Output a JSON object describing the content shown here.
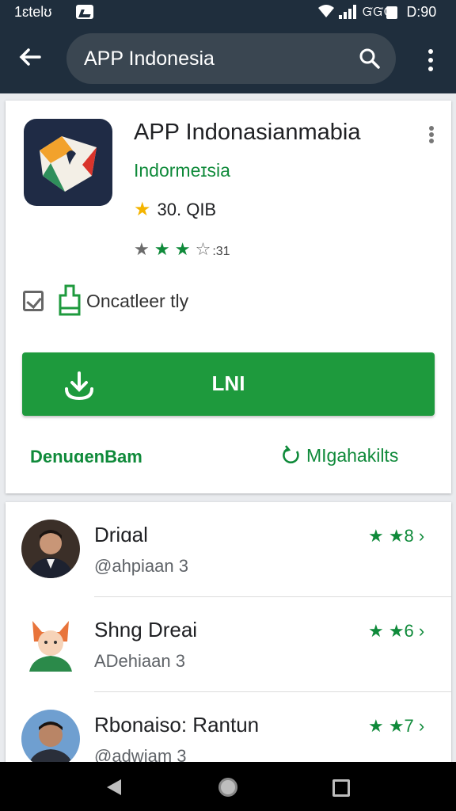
{
  "status_bar": {
    "carrier": "1ɛtelʊ",
    "network": "ᏳᏳᏳ",
    "time": "Ꭰ:90",
    "icons": [
      "image-icon",
      "wifi-icon",
      "signal-icon",
      "battery-icon"
    ]
  },
  "search": {
    "query": "APP Indonesia",
    "icons": [
      "back-arrow-icon",
      "search-icon",
      "overflow-menu-icon"
    ]
  },
  "app": {
    "title": "APP Indonasianmabia",
    "developer": "Indormeɪsia",
    "rating_text": "30. QIB",
    "stars_full": 3,
    "review_count": ":31",
    "badge_label": "Oncatleer tly",
    "install_label": "LNI",
    "link_left": "DenuɑenBam",
    "link_right": "MIgahakilts",
    "colors": {
      "accent": "#1e9a3d",
      "header": "#1f2e3d",
      "star": "#f4b400"
    }
  },
  "reviews": [
    {
      "name": "Driɑal",
      "sub": "@ahpiaan 3",
      "score": "★ ★8 ›"
    },
    {
      "name": "Shng Dreai",
      "sub": "ADehiaan 3",
      "score": "★ ★6 ›"
    },
    {
      "name": "Rbonaiso: Rantun",
      "sub": "@adwiam 3",
      "score": "★ ★7 ›"
    }
  ],
  "nav": {
    "icons": [
      "nav-back-icon",
      "nav-home-icon",
      "nav-recent-icon"
    ]
  }
}
